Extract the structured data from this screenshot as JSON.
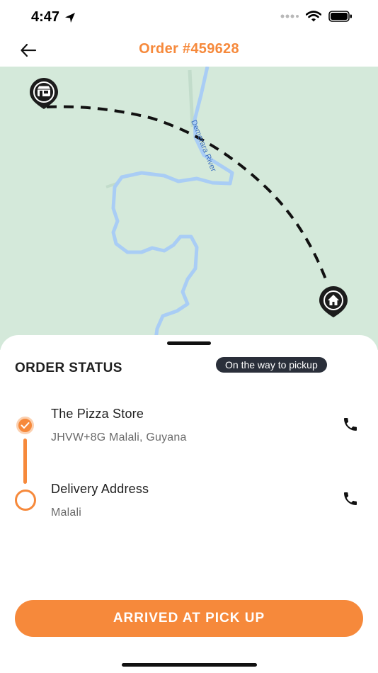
{
  "status_bar": {
    "time": "4:47",
    "location_icon": "location-arrow-icon",
    "signal_icon": "cellular-signal-icon",
    "wifi_icon": "wifi-icon",
    "battery_icon": "battery-icon"
  },
  "header": {
    "back_icon": "back-arrow-icon",
    "title": "Order #459628",
    "title_color": "#f6893b"
  },
  "map": {
    "river_label": "Demerara River",
    "pickup_marker_icon": "store-pin-icon",
    "delivery_marker_icon": "home-pin-icon",
    "land_color": "#d4e9da",
    "water_color": "#a9cdf5"
  },
  "order_status": {
    "title": "ORDER STATUS",
    "badge": "On the way to pickup",
    "stops": [
      {
        "name": "The Pizza Store",
        "address": "JHVW+8G Malali, Guyana",
        "state": "done",
        "call_icon": "phone-icon"
      },
      {
        "name": "Delivery Address",
        "address": "Malali",
        "state": "pending",
        "call_icon": "phone-icon"
      }
    ]
  },
  "actions": {
    "primary_label": "ARRIVED AT PICK UP",
    "accent_color": "#f6893b"
  }
}
